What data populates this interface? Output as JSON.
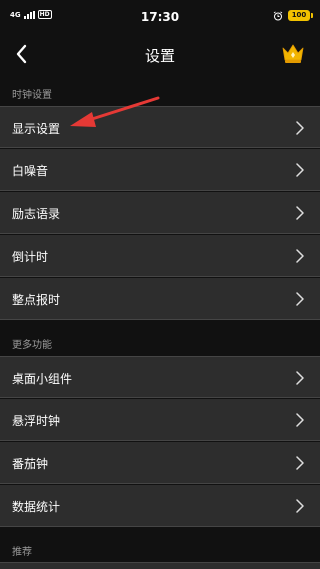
{
  "status_bar": {
    "network": "4G",
    "hd": "HD",
    "time": "17:30",
    "battery": "100"
  },
  "nav": {
    "title": "设置"
  },
  "sections": {
    "clock": {
      "title": "时钟设置",
      "items": [
        "显示设置",
        "白噪音",
        "励志语录",
        "倒计时",
        "整点报时"
      ]
    },
    "more": {
      "title": "更多功能",
      "items": [
        "桌面小组件",
        "悬浮时钟",
        "番茄钟",
        "数据统计"
      ]
    },
    "recommend": {
      "title": "推荐"
    }
  },
  "colors": {
    "background": "#111111",
    "row": "#2d2d2d",
    "divider": "#454545",
    "section_text": "#9a9a9a",
    "accent": "#f2c200",
    "annotation_arrow": "#e53935"
  },
  "icons": {
    "back": "chevron-left-icon",
    "vip": "crown-icon",
    "row_chevron": "chevron-right-icon",
    "alarm": "alarm-clock-icon"
  }
}
